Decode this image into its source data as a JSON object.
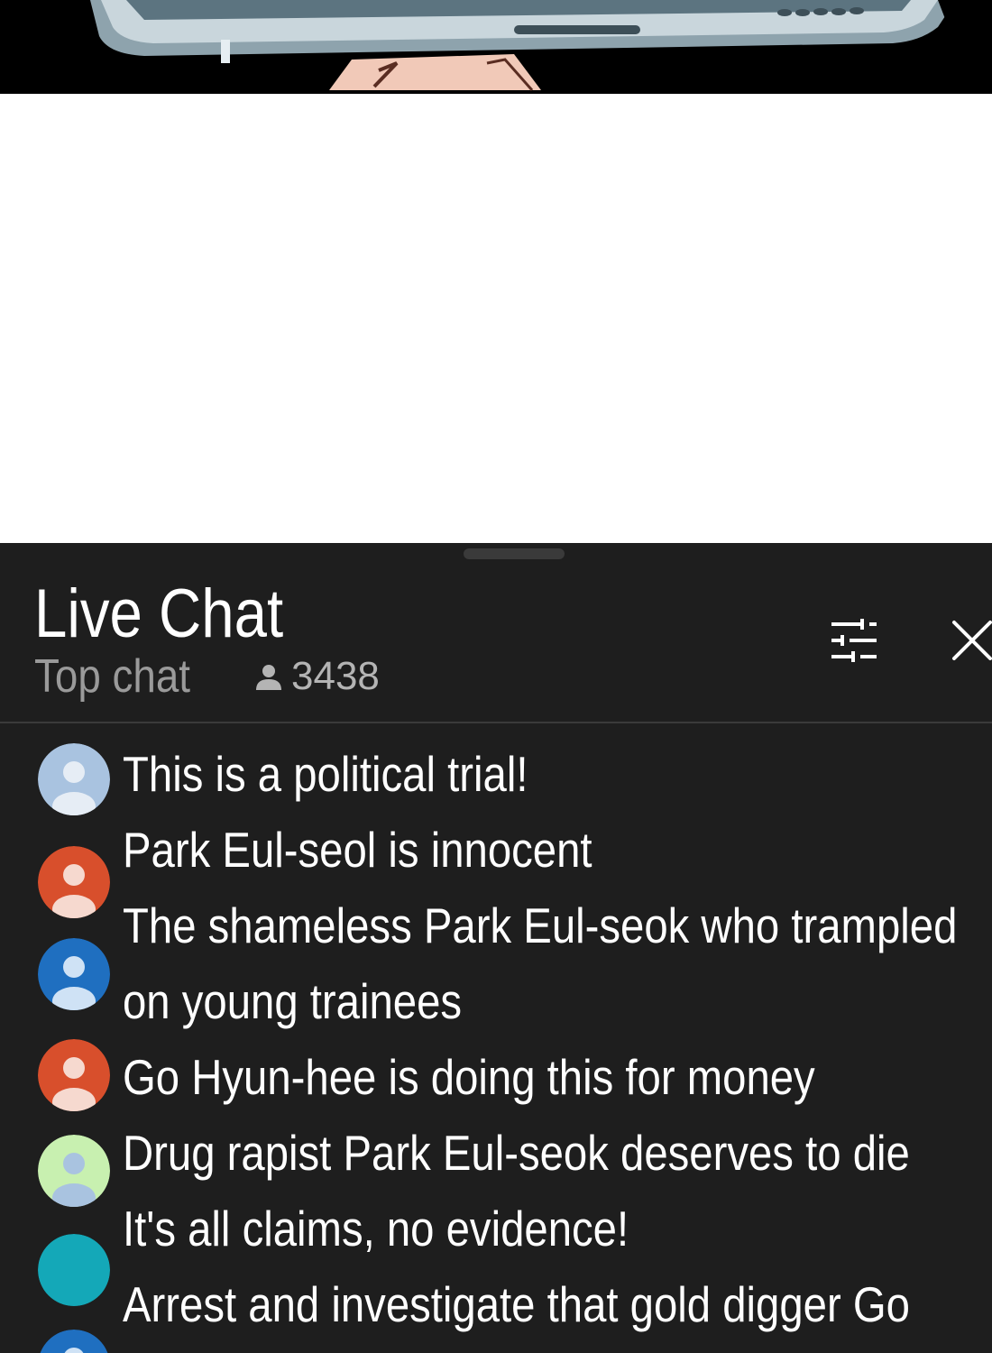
{
  "chat": {
    "title": "Live Chat",
    "subtitle": "Top chat",
    "viewer_count": "3438",
    "icons": {
      "viewers": "person-icon",
      "filter": "filter-sliders-icon",
      "close": "close-icon"
    }
  },
  "messages": [
    {
      "text": "This is a political trial!",
      "avatar_color": "#a9c3e0",
      "avatar_icon": "person-silhouette"
    },
    {
      "text": "Park Eul-seol is innocent",
      "avatar_color": "#d84f2c",
      "avatar_icon": "person-silhouette"
    },
    {
      "text": "The shameless Park Eul-seok who trampled",
      "avatar_color": "#1f6fc0",
      "avatar_icon": "person-silhouette"
    },
    {
      "text": "on young trainees"
    },
    {
      "text": "Go Hyun-hee is doing this for money",
      "avatar_color": "#d84f2c",
      "avatar_icon": "person-silhouette"
    },
    {
      "text": "Drug rapist Park Eul-seok deserves to die",
      "avatar_color": "#c8f0b0",
      "avatar_icon": "person-silhouette"
    },
    {
      "text": "It's all claims, no evidence!",
      "avatar_color": "#14a8b8"
    },
    {
      "text": "Arrest and investigate that gold digger Go",
      "avatar_color": "#1f6fc0"
    }
  ]
}
